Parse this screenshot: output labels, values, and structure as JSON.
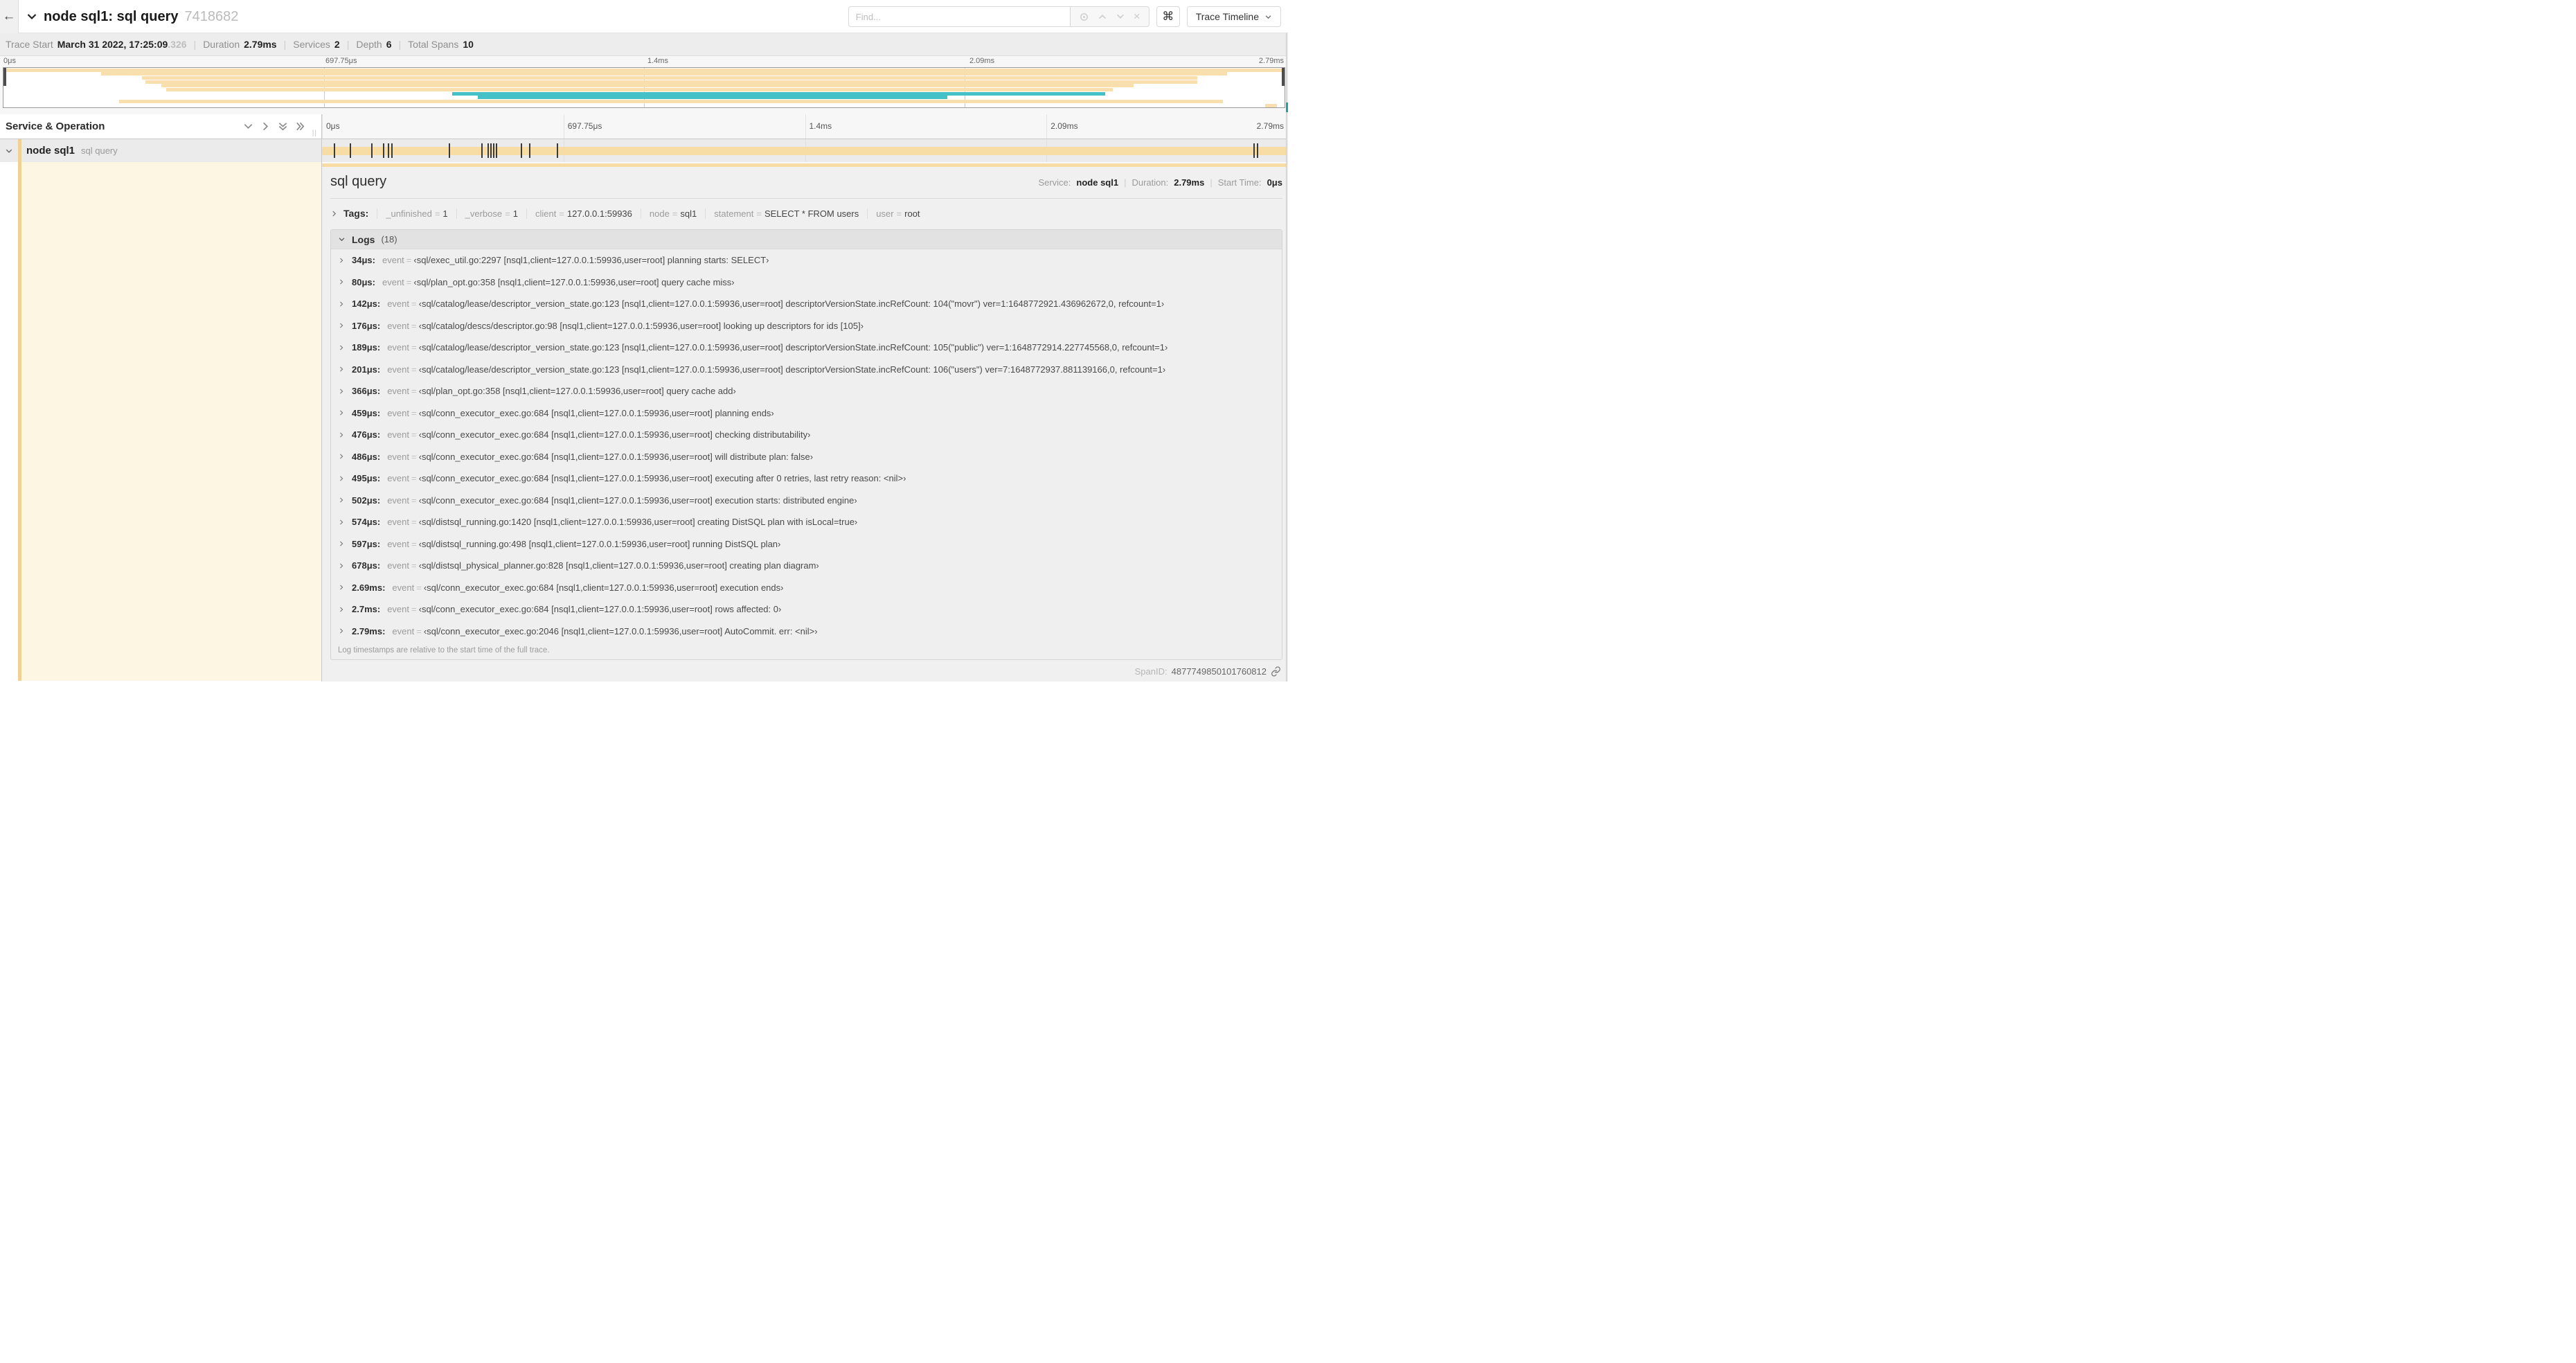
{
  "colors": {
    "tan": "#f8dfad",
    "teal": "#43c1c6",
    "accent": "#efd195",
    "cream": "#fcf6e3",
    "bar": "#f7dca4"
  },
  "header": {
    "back_icon": "←",
    "title": "node sql1: sql query",
    "trace_id": "7418682",
    "find_placeholder": "Find...",
    "clear_icon": "×",
    "keyboard_shortcut": "⌘",
    "view_select_label": "Trace Timeline"
  },
  "meta": {
    "items": [
      {
        "label": "Trace Start",
        "value": "March 31 2022, 17:25:09",
        "fraction": ".326"
      },
      {
        "label": "Duration",
        "value": "2.79ms"
      },
      {
        "label": "Services",
        "value": "2"
      },
      {
        "label": "Depth",
        "value": "6"
      },
      {
        "label": "Total Spans",
        "value": "10"
      }
    ]
  },
  "timeline": {
    "ticks": [
      "0μs",
      "697.75μs",
      "1.4ms",
      "2.09ms",
      "2.79ms"
    ],
    "tick_positions": [
      0,
      25,
      50,
      75,
      100
    ]
  },
  "minimap": {
    "spans": [
      {
        "l": 0,
        "w": 100,
        "c": "tan"
      },
      {
        "l": 7.6,
        "w": 87.9,
        "c": "tan"
      },
      {
        "l": 10.8,
        "w": 82.4,
        "c": "tan"
      },
      {
        "l": 11.1,
        "w": 82.1,
        "c": "tan"
      },
      {
        "l": 12.3,
        "w": 75.9,
        "c": "tan"
      },
      {
        "l": 12.7,
        "w": 73.9,
        "c": "tan"
      },
      {
        "l": 35.0,
        "w": 51.0,
        "c": "teal"
      },
      {
        "l": 37.0,
        "w": 36.7,
        "c": "teal"
      },
      {
        "l": 9.0,
        "w": 86.2,
        "c": "tan"
      },
      {
        "l": 98.5,
        "w": 0.9,
        "c": "tan"
      }
    ]
  },
  "table": {
    "header_title": "Service & Operation",
    "row": {
      "service": "node sql1",
      "operation": "sql query"
    },
    "log_tick_positions": [
      1.2,
      2.9,
      5.1,
      6.3,
      6.8,
      7.2,
      13.1,
      16.5,
      17.1,
      17.4,
      17.7,
      18.0,
      20.6,
      21.4,
      24.3,
      96.4,
      96.8,
      99.8
    ]
  },
  "detail": {
    "title": "sql query",
    "stats": [
      {
        "label": "Service:",
        "value": "node sql1"
      },
      {
        "label": "Duration:",
        "value": "2.79ms"
      },
      {
        "label": "Start Time:",
        "value": "0μs"
      }
    ],
    "tags": {
      "label": "Tags:",
      "items": [
        {
          "key": "_unfinished",
          "value": "1"
        },
        {
          "key": "_verbose",
          "value": "1"
        },
        {
          "key": "client",
          "value": "127.0.0.1:59936"
        },
        {
          "key": "node",
          "value": "sql1"
        },
        {
          "key": "statement",
          "value": "SELECT * FROM users"
        },
        {
          "key": "user",
          "value": "root"
        }
      ]
    },
    "logs": {
      "title": "Logs",
      "count": "(18)",
      "field_key": "event",
      "entries": [
        {
          "time": "34μs:",
          "msg": "‹sql/exec_util.go:2297 [nsql1,client=127.0.0.1:59936,user=root] planning starts: SELECT›"
        },
        {
          "time": "80μs:",
          "msg": "‹sql/plan_opt.go:358 [nsql1,client=127.0.0.1:59936,user=root] query cache miss›"
        },
        {
          "time": "142μs:",
          "msg": "‹sql/catalog/lease/descriptor_version_state.go:123 [nsql1,client=127.0.0.1:59936,user=root] descriptorVersionState.incRefCount: 104(\"movr\") ver=1:1648772921.436962672,0, refcount=1›"
        },
        {
          "time": "176μs:",
          "msg": "‹sql/catalog/descs/descriptor.go:98 [nsql1,client=127.0.0.1:59936,user=root] looking up descriptors for ids [105]›"
        },
        {
          "time": "189μs:",
          "msg": "‹sql/catalog/lease/descriptor_version_state.go:123 [nsql1,client=127.0.0.1:59936,user=root] descriptorVersionState.incRefCount: 105(\"public\") ver=1:1648772914.227745568,0, refcount=1›"
        },
        {
          "time": "201μs:",
          "msg": "‹sql/catalog/lease/descriptor_version_state.go:123 [nsql1,client=127.0.0.1:59936,user=root] descriptorVersionState.incRefCount: 106(\"users\") ver=7:1648772937.881139166,0, refcount=1›"
        },
        {
          "time": "366μs:",
          "msg": "‹sql/plan_opt.go:358 [nsql1,client=127.0.0.1:59936,user=root] query cache add›"
        },
        {
          "time": "459μs:",
          "msg": "‹sql/conn_executor_exec.go:684 [nsql1,client=127.0.0.1:59936,user=root] planning ends›"
        },
        {
          "time": "476μs:",
          "msg": "‹sql/conn_executor_exec.go:684 [nsql1,client=127.0.0.1:59936,user=root] checking distributability›"
        },
        {
          "time": "486μs:",
          "msg": "‹sql/conn_executor_exec.go:684 [nsql1,client=127.0.0.1:59936,user=root] will distribute plan: false›"
        },
        {
          "time": "495μs:",
          "msg": "‹sql/conn_executor_exec.go:684 [nsql1,client=127.0.0.1:59936,user=root] executing after 0 retries, last retry reason: <nil>›"
        },
        {
          "time": "502μs:",
          "msg": "‹sql/conn_executor_exec.go:684 [nsql1,client=127.0.0.1:59936,user=root] execution starts: distributed engine›"
        },
        {
          "time": "574μs:",
          "msg": "‹sql/distsql_running.go:1420 [nsql1,client=127.0.0.1:59936,user=root] creating DistSQL plan with isLocal=true›"
        },
        {
          "time": "597μs:",
          "msg": "‹sql/distsql_running.go:498 [nsql1,client=127.0.0.1:59936,user=root] running DistSQL plan›"
        },
        {
          "time": "678μs:",
          "msg": "‹sql/distsql_physical_planner.go:828 [nsql1,client=127.0.0.1:59936,user=root] creating plan diagram›"
        },
        {
          "time": "2.69ms:",
          "msg": "‹sql/conn_executor_exec.go:684 [nsql1,client=127.0.0.1:59936,user=root] execution ends›"
        },
        {
          "time": "2.7ms:",
          "msg": "‹sql/conn_executor_exec.go:684 [nsql1,client=127.0.0.1:59936,user=root] rows affected: 0›"
        },
        {
          "time": "2.79ms:",
          "msg": "‹sql/conn_executor_exec.go:2046 [nsql1,client=127.0.0.1:59936,user=root] AutoCommit. err: <nil>›"
        }
      ],
      "note": "Log timestamps are relative to the start time of the full trace."
    },
    "span_id_label": "SpanID:",
    "span_id": "4877749850101760812"
  }
}
